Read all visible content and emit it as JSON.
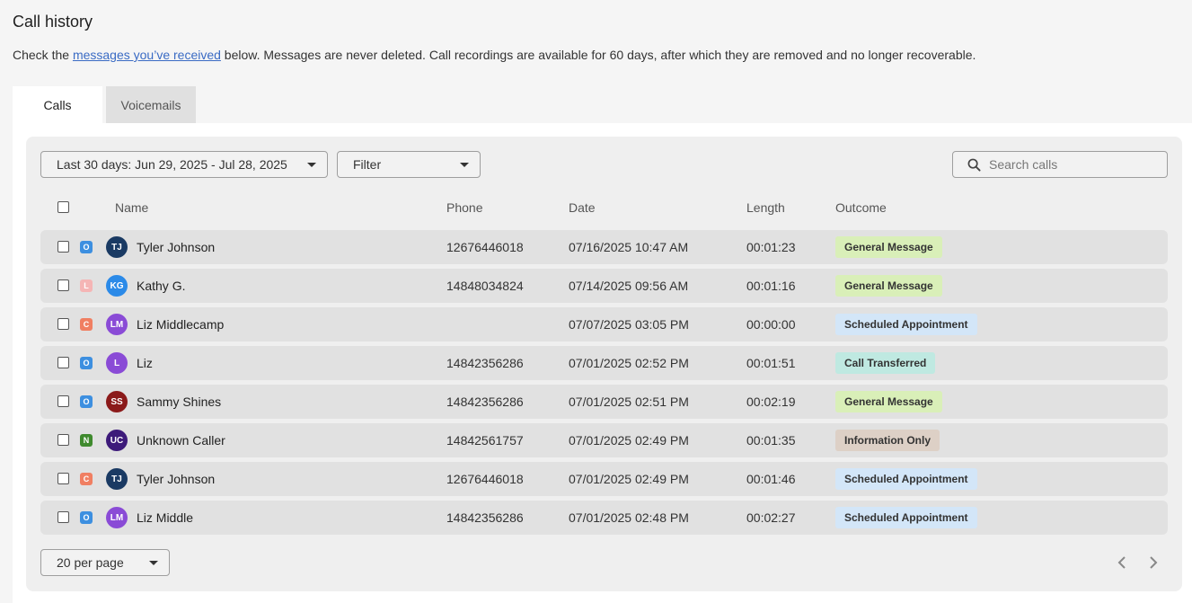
{
  "page": {
    "title": "Call history",
    "intro_before": "Check the ",
    "intro_link": "messages you’ve received",
    "intro_after": " below. Messages are never deleted. Call recordings are available for 60 days, after which they are removed and no longer recoverable."
  },
  "tabs": [
    {
      "label": "Calls",
      "active": true
    },
    {
      "label": "Voicemails",
      "active": false
    }
  ],
  "toolbar": {
    "date_range": "Last 30 days: Jun 29, 2025 - Jul 28, 2025",
    "filter": "Filter",
    "search_placeholder": "Search calls"
  },
  "columns": {
    "name": "Name",
    "phone": "Phone",
    "date": "Date",
    "length": "Length",
    "outcome": "Outcome"
  },
  "tag_colors": {
    "O": "#3d8fe0",
    "L": "#f5b5b5",
    "C": "#f07f62",
    "N": "#3f8a2e"
  },
  "outcome_colors": {
    "General Message": "#d9efb8",
    "Scheduled Appointment": "#d3e6f8",
    "Call Transferred": "#bfe9e1",
    "Information Only": "#ddd0c6"
  },
  "calls": [
    {
      "tag": "O",
      "initials": "TJ",
      "avatar_color": "#1a3a63",
      "name": "Tyler Johnson",
      "phone": "12676446018",
      "date": "07/16/2025 10:47 AM",
      "length": "00:01:23",
      "outcome": "General Message"
    },
    {
      "tag": "L",
      "initials": "KG",
      "avatar_color": "#2b8ae8",
      "name": "Kathy G.",
      "phone": "14848034824",
      "date": "07/14/2025 09:56 AM",
      "length": "00:01:16",
      "outcome": "General Message"
    },
    {
      "tag": "C",
      "initials": "LM",
      "avatar_color": "#8a4bd6",
      "name": "Liz Middlecamp",
      "phone": "",
      "date": "07/07/2025 03:05 PM",
      "length": "00:00:00",
      "outcome": "Scheduled Appointment"
    },
    {
      "tag": "O",
      "initials": "L",
      "avatar_color": "#8a4bd6",
      "name": "Liz",
      "phone": "14842356286",
      "date": "07/01/2025 02:52 PM",
      "length": "00:01:51",
      "outcome": "Call Transferred"
    },
    {
      "tag": "O",
      "initials": "SS",
      "avatar_color": "#8b1a1a",
      "name": "Sammy Shines",
      "phone": "14842356286",
      "date": "07/01/2025 02:51 PM",
      "length": "00:02:19",
      "outcome": "General Message"
    },
    {
      "tag": "N",
      "initials": "UC",
      "avatar_color": "#3d1a7a",
      "name": "Unknown Caller",
      "phone": "14842561757",
      "date": "07/01/2025 02:49 PM",
      "length": "00:01:35",
      "outcome": "Information Only"
    },
    {
      "tag": "C",
      "initials": "TJ",
      "avatar_color": "#1a3a63",
      "name": "Tyler Johnson",
      "phone": "12676446018",
      "date": "07/01/2025 02:49 PM",
      "length": "00:01:46",
      "outcome": "Scheduled Appointment"
    },
    {
      "tag": "O",
      "initials": "LM",
      "avatar_color": "#8a4bd6",
      "name": "Liz Middle",
      "phone": "14842356286",
      "date": "07/01/2025 02:48 PM",
      "length": "00:02:27",
      "outcome": "Scheduled Appointment"
    }
  ],
  "pager": {
    "per_page": "20 per page",
    "prev_icon": "chevron-left-icon",
    "next_icon": "chevron-right-icon"
  }
}
